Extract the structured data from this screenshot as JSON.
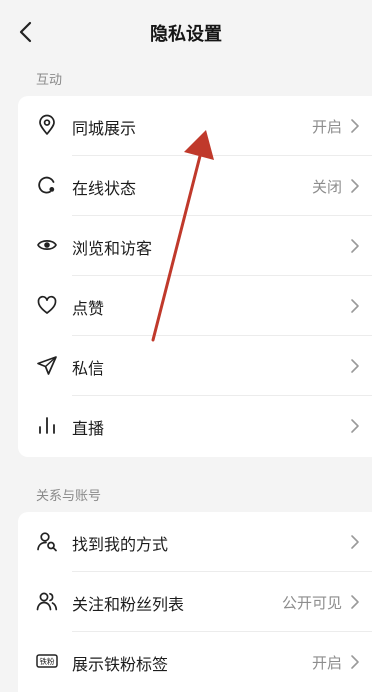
{
  "header": {
    "title": "隐私设置"
  },
  "sections": {
    "interaction": {
      "label": "互动",
      "items": [
        {
          "label": "同城展示",
          "value": "开启"
        },
        {
          "label": "在线状态",
          "value": "关闭"
        },
        {
          "label": "浏览和访客",
          "value": ""
        },
        {
          "label": "点赞",
          "value": ""
        },
        {
          "label": "私信",
          "value": ""
        },
        {
          "label": "直播",
          "value": ""
        }
      ]
    },
    "relations": {
      "label": "关系与账号",
      "items": [
        {
          "label": "找到我的方式",
          "value": ""
        },
        {
          "label": "关注和粉丝列表",
          "value": "公开可见"
        },
        {
          "label": "展示铁粉标签",
          "value": "开启"
        }
      ]
    }
  },
  "icons": {
    "back": "chevron-left-icon",
    "location": "location-pin-icon",
    "online": "online-status-icon",
    "views": "eye-icon",
    "like": "heart-icon",
    "message": "paper-plane-icon",
    "live": "bars-icon",
    "find": "person-search-icon",
    "follow": "people-icon",
    "fan_badge": "fan-badge-icon",
    "chevron": "chevron-right-icon"
  },
  "iron_fan_badge_text": "铁粉",
  "colors": {
    "background": "#f4f4f4",
    "card": "#ffffff",
    "annotation_arrow": "#c0392b"
  }
}
